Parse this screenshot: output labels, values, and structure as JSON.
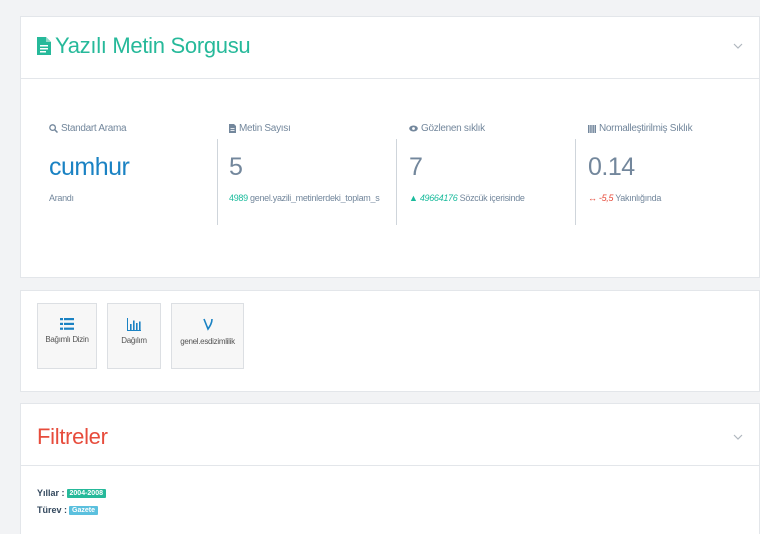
{
  "query_panel": {
    "title": "Yazılı Metin Sorgusu",
    "stats": [
      {
        "label": "Standart Arama",
        "value": "cumhur",
        "sub": "Arandı",
        "sub_prefix": ""
      },
      {
        "label": "Metin Sayısı",
        "value": "5",
        "sub_prefix": "4989",
        "sub": " genel.yazili_metinlerdeki_toplam_s"
      },
      {
        "label": "Gözlenen sıklık",
        "value": "7",
        "sub_prefix": "49664176",
        "sub": " Sözcük içerisinde"
      },
      {
        "label": "Normalleştirilmiş Sıklık",
        "value": "0.14",
        "sub_prefix": "-5,5",
        "sub": " Yakınlığında"
      }
    ]
  },
  "tools": [
    {
      "label": "Bağımlı Dizin",
      "icon": "list-icon"
    },
    {
      "label": "Dağılım",
      "icon": "bar-chart-icon"
    },
    {
      "label": "genel.esdizimlilik",
      "icon": "nu-icon"
    }
  ],
  "filters_panel": {
    "title": "Filtreler",
    "rows": [
      {
        "label": "Yıllar :",
        "tag": "2004-2008",
        "tag_color": "#26b99a"
      },
      {
        "label": "Türev :",
        "tag": "Gazete",
        "tag_color": "#5bc0de"
      }
    ]
  },
  "colors": {
    "accent_green": "#26b99a",
    "accent_blue": "#1a82c3",
    "accent_red": "#e74c3c"
  }
}
